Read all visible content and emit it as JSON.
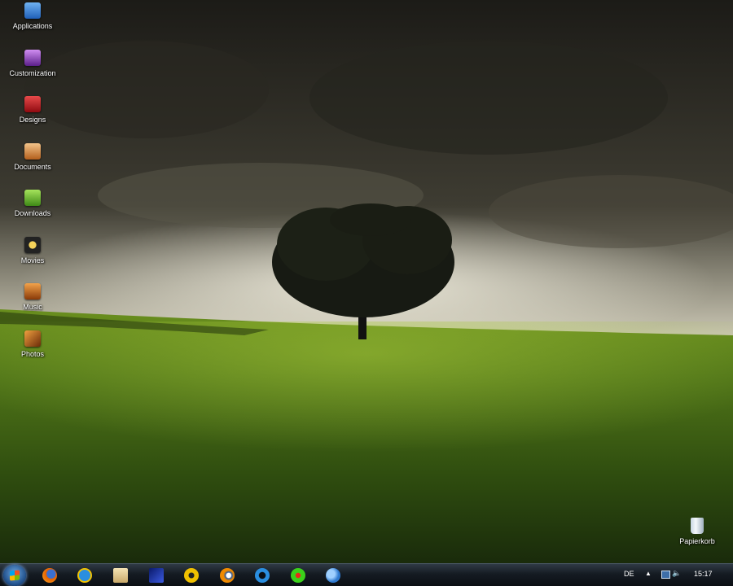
{
  "desktop": {
    "icons": [
      {
        "label": "Applications",
        "icon": "app-store-icon",
        "color": "#3b7fd6"
      },
      {
        "label": "Customization",
        "icon": "customization-icon",
        "color": "#8a3fb8"
      },
      {
        "label": "Designs",
        "icon": "designs-folder-icon",
        "color": "#c0141c"
      },
      {
        "label": "Documents",
        "icon": "documents-icon",
        "color": "#d98a3a"
      },
      {
        "label": "Downloads",
        "icon": "downloads-icon",
        "color": "#6aba2e"
      },
      {
        "label": "Movies",
        "icon": "movies-icon",
        "color": "#e0b020"
      },
      {
        "label": "Music",
        "icon": "music-icon",
        "color": "#e07a18"
      },
      {
        "label": "Photos",
        "icon": "photos-icon",
        "color": "#d6751a"
      }
    ],
    "recycle_bin": {
      "label": "Papierkorb",
      "icon": "recycle-bin-icon"
    }
  },
  "taskbar": {
    "start": {
      "icon": "windows-start-icon"
    },
    "pinned": [
      {
        "icon": "firefox-icon",
        "color": "#e66000"
      },
      {
        "icon": "internet-explorer-icon",
        "color": "#2a8ee0"
      },
      {
        "icon": "notes-icon",
        "color": "#e8d29a"
      },
      {
        "icon": "blue-app-icon",
        "color": "#1b3aa6"
      },
      {
        "icon": "radiation-app-icon",
        "color": "#e0a800"
      },
      {
        "icon": "blender-icon",
        "color": "#f08a00"
      },
      {
        "icon": "edge-e-icon",
        "color": "#2a8ee0"
      },
      {
        "icon": "icq-flower-icon",
        "color": "#3bd11a"
      },
      {
        "icon": "messenger-icon",
        "color": "#5fa8e8"
      }
    ],
    "tray": {
      "language": "DE",
      "show_hidden_icon": "chevron-up-icon",
      "network_icon": "network-icon",
      "volume_icon": "volume-icon",
      "clock": "15:17"
    }
  }
}
